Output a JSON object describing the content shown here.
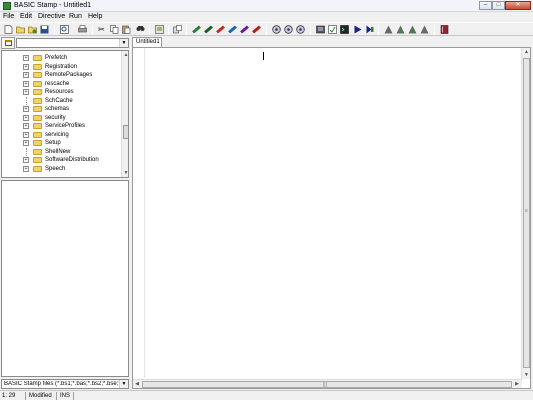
{
  "window": {
    "title": "BASIC Stamp - Untitled1"
  },
  "menu": [
    "File",
    "Edit",
    "Directive",
    "Run",
    "Help"
  ],
  "toolbar": {
    "icons": [
      "new-file-icon",
      "open-folder-icon",
      "open-recent-icon",
      "save-icon",
      "preview-icon",
      "print-icon",
      "cut-icon",
      "copy-icon",
      "paste-icon",
      "find-icon",
      "memory-map-icon",
      "debug-terminal-icon",
      "stamp-bs1-icon",
      "stamp-bs2-icon",
      "stamp-bs2e-icon",
      "stamp-bs2sx-icon",
      "stamp-bs2p-icon",
      "stamp-bs2pe-icon",
      "identify-icon",
      "identify-all-icon",
      "identify-port-icon",
      "memory-window-icon",
      "check-syntax-icon",
      "terminal-icon",
      "run-icon",
      "debug-icon",
      "directive-1-icon",
      "directive-2-icon",
      "directive-3-icon",
      "directive-4-icon",
      "help-book-icon"
    ]
  },
  "file_browser": {
    "folders": [
      {
        "name": "Prefetch",
        "expandable": true
      },
      {
        "name": "Registration",
        "expandable": true
      },
      {
        "name": "RemotePackages",
        "expandable": true
      },
      {
        "name": "rescache",
        "expandable": true
      },
      {
        "name": "Resources",
        "expandable": true
      },
      {
        "name": "SchCache",
        "expandable": false
      },
      {
        "name": "schemas",
        "expandable": true
      },
      {
        "name": "security",
        "expandable": true
      },
      {
        "name": "ServiceProfiles",
        "expandable": true
      },
      {
        "name": "servicing",
        "expandable": true
      },
      {
        "name": "Setup",
        "expandable": true
      },
      {
        "name": "ShellNew",
        "expandable": false
      },
      {
        "name": "SoftwareDistribution",
        "expandable": true
      },
      {
        "name": "Speech",
        "expandable": true
      }
    ],
    "filter": "BASIC Stamp files (*.bs1;*.bas;*.bs2;*.bse;*.bsx"
  },
  "editor": {
    "tab_label": "Untitled1"
  },
  "status": {
    "position": "1: 29",
    "modified": "Modified",
    "mode": "INS"
  },
  "colors": {
    "folder": "#f2d36b",
    "title_bg": "#f1f4f8",
    "close_button": "#c94a35"
  }
}
